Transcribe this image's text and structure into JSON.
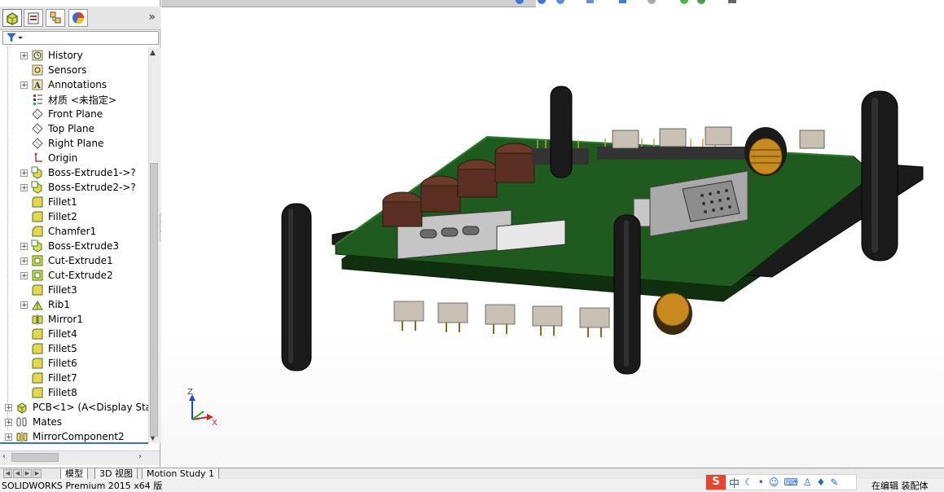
{
  "feature_tree": {
    "filter_icon": "funnel-icon",
    "items": [
      {
        "label": "History",
        "icon": "history-icon",
        "expander": "+",
        "level": 1
      },
      {
        "label": "Sensors",
        "icon": "sensors-icon",
        "expander": "",
        "level": 1
      },
      {
        "label": "Annotations",
        "icon": "annotations-icon",
        "expander": "+",
        "level": 1
      },
      {
        "label": "材质 <未指定>",
        "icon": "material-icon",
        "expander": "",
        "level": 1
      },
      {
        "label": "Front Plane",
        "icon": "plane-icon",
        "expander": "",
        "level": 1
      },
      {
        "label": "Top Plane",
        "icon": "plane-icon",
        "expander": "",
        "level": 1
      },
      {
        "label": "Right Plane",
        "icon": "plane-icon",
        "expander": "",
        "level": 1
      },
      {
        "label": "Origin",
        "icon": "origin-icon",
        "expander": "",
        "level": 1
      },
      {
        "label": "Boss-Extrude1->?",
        "icon": "boss-extrude-icon",
        "expander": "+",
        "level": 1
      },
      {
        "label": "Boss-Extrude2->?",
        "icon": "boss-extrude-icon",
        "expander": "+",
        "level": 1
      },
      {
        "label": "Fillet1",
        "icon": "fillet-icon",
        "expander": "",
        "level": 1
      },
      {
        "label": "Fillet2",
        "icon": "fillet-icon",
        "expander": "",
        "level": 1
      },
      {
        "label": "Chamfer1",
        "icon": "chamfer-icon",
        "expander": "",
        "level": 1
      },
      {
        "label": "Boss-Extrude3",
        "icon": "boss-extrude-icon",
        "expander": "+",
        "level": 1
      },
      {
        "label": "Cut-Extrude1",
        "icon": "cut-extrude-icon",
        "expander": "+",
        "level": 1
      },
      {
        "label": "Cut-Extrude2",
        "icon": "cut-extrude-icon",
        "expander": "+",
        "level": 1
      },
      {
        "label": "Fillet3",
        "icon": "fillet-icon",
        "expander": "",
        "level": 1
      },
      {
        "label": "Rib1",
        "icon": "rib-icon",
        "expander": "+",
        "level": 1
      },
      {
        "label": "Mirror1",
        "icon": "mirror-icon",
        "expander": "",
        "level": 1
      },
      {
        "label": "Fillet4",
        "icon": "fillet-icon",
        "expander": "",
        "level": 1
      },
      {
        "label": "Fillet5",
        "icon": "fillet-icon",
        "expander": "",
        "level": 1
      },
      {
        "label": "Fillet6",
        "icon": "fillet-icon",
        "expander": "",
        "level": 1
      },
      {
        "label": "Fillet7",
        "icon": "fillet-icon",
        "expander": "",
        "level": 1
      },
      {
        "label": "Fillet8",
        "icon": "fillet-icon",
        "expander": "",
        "level": 1
      },
      {
        "label": "PCB<1> (A<Display Stat",
        "icon": "part-icon",
        "expander": "+",
        "level": 0
      },
      {
        "label": "Mates",
        "icon": "mates-icon",
        "expander": "+",
        "level": 0
      },
      {
        "label": "MirrorComponent2",
        "icon": "mirror-component-icon",
        "expander": "+",
        "level": 0
      }
    ]
  },
  "triad": {
    "z": "Z",
    "x": "X"
  },
  "bottom_tabs": [
    "模型",
    "3D 视图",
    "Motion Study 1"
  ],
  "status": {
    "app_name": "SOLIDWORKS Premium 2015 x64 版",
    "state": "在编辑 装配体",
    "ime_char": "中"
  },
  "colors": {
    "pcb_green": "#1f5a1f",
    "pcb_dark": "#0d2a0d",
    "handle": "#1a1a1a",
    "capacitor": "#6b3a2a",
    "coil": "#c88a1e"
  }
}
